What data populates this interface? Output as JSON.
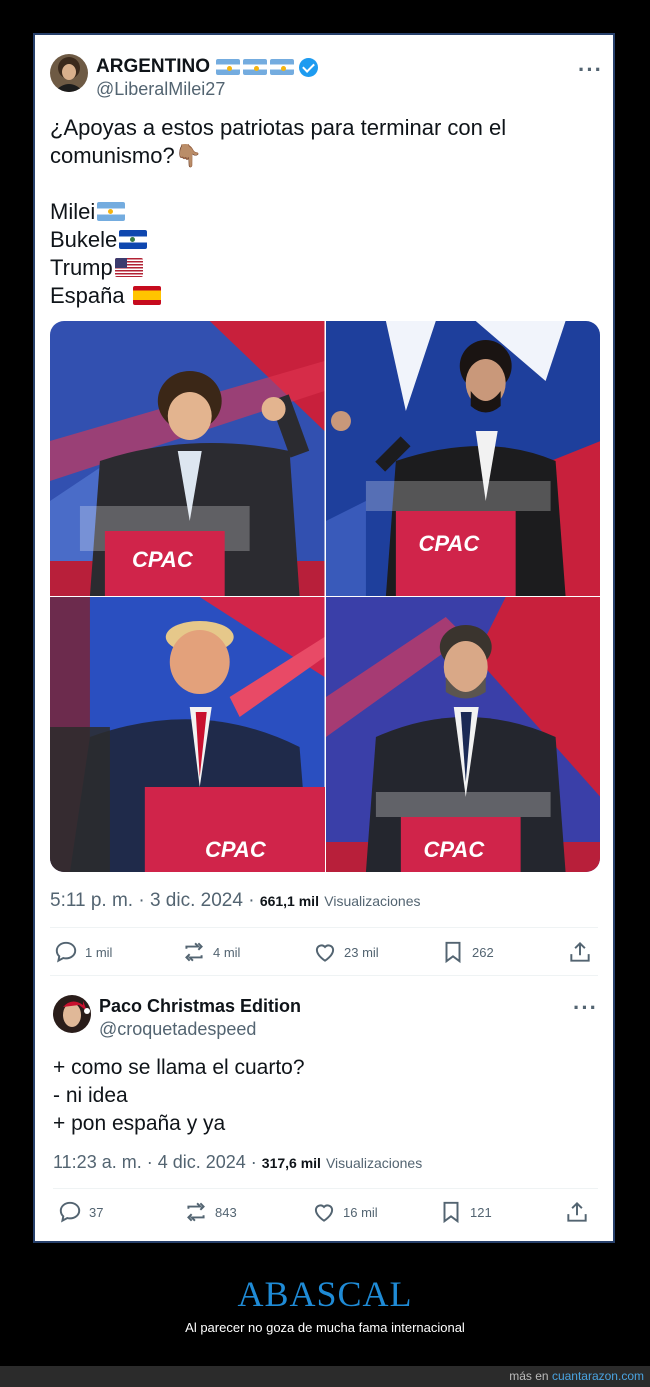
{
  "tweet1": {
    "author_name": "ARGENTINO",
    "handle": "@LiberalMilei27",
    "text_line1": "¿Apoyas a estos patriotas para terminar con el",
    "text_line2": "comunismo?👇🏽",
    "list": [
      "Milei",
      "Bukele",
      "Trump",
      "España"
    ],
    "photo_labels": [
      "CPAC",
      "CPAC",
      "CPAC",
      "CPAC"
    ],
    "time": "5:11 p. m. · 3 dic. 2024 ·",
    "views_count": "661,1 mil",
    "views_label": "Visualizaciones",
    "replies": "1 mil",
    "reposts": "4 mil",
    "likes": "23 mil",
    "bookmarks": "262"
  },
  "tweet2": {
    "author_name": "Paco Christmas Edition",
    "handle": "@croquetadespeed",
    "lines": [
      "+ como se llama el cuarto?",
      "- ni idea",
      "+ pon españa y ya"
    ],
    "time": "11:23 a. m. · 4 dic. 2024 ·",
    "views_count": "317,6 mil",
    "views_label": "Visualizaciones",
    "replies": "37",
    "reposts": "843",
    "likes": "16 mil",
    "bookmarks": "121"
  },
  "more_glyph": "···",
  "footer": {
    "title": "ABASCAL",
    "subtitle": "Al parecer no goza de mucha fama internacional",
    "source_prefix": "más en",
    "source_link": "cuantarazon.com"
  },
  "colors": {
    "accent": "#1f8bd6",
    "verified": "#1d9bf0",
    "secondary_text": "#536471",
    "card_border": "#27406b"
  }
}
